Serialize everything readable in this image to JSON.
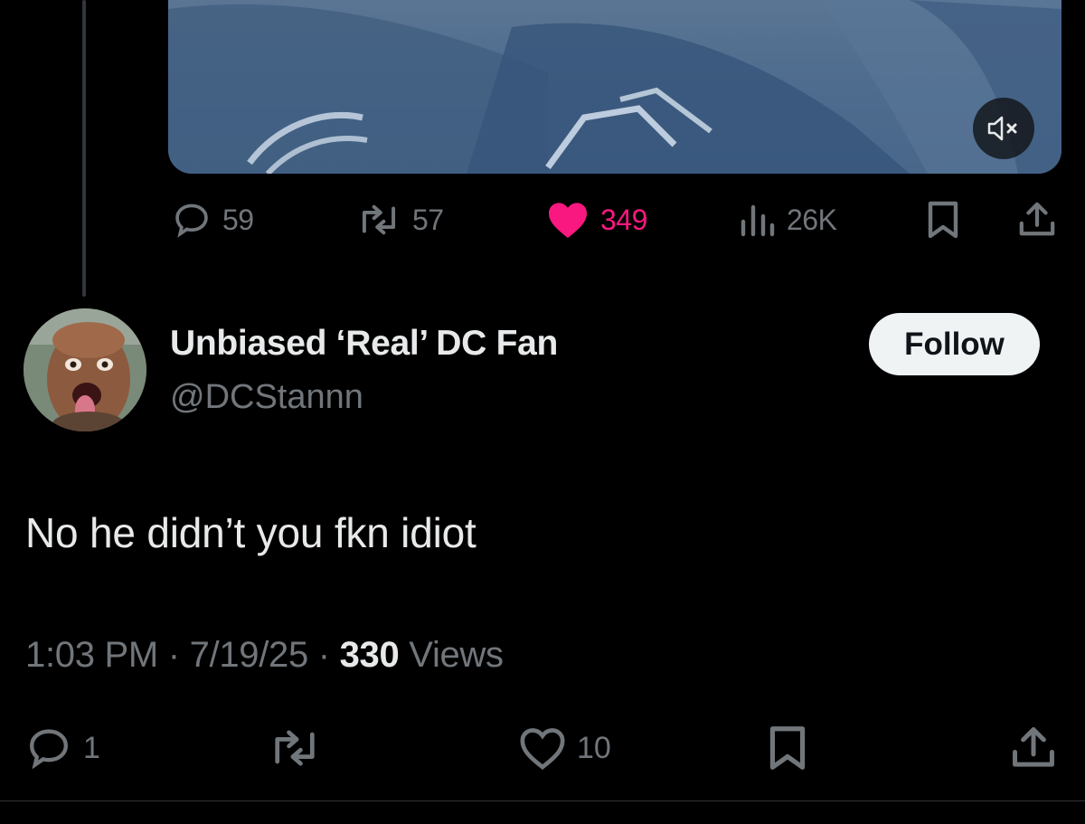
{
  "colors": {
    "background": "#000000",
    "text": "#e7e9ea",
    "muted": "#71767b",
    "like": "#f91880",
    "follow_bg": "#eff3f4"
  },
  "parent_post": {
    "media": {
      "type": "video",
      "mute_icon": "volume-muted-icon"
    },
    "actions": {
      "replies": "59",
      "reposts": "57",
      "likes": "349",
      "views": "26K"
    }
  },
  "reply": {
    "display_name": "Unbiased ‘Real’ DC Fan",
    "handle": "@DCStannn",
    "follow_label": "Follow",
    "text": "No he didn’t you fkn idiot",
    "time": "1:03 PM",
    "date": "7/19/25",
    "views_count": "330",
    "views_label": "Views",
    "separator": "·",
    "actions": {
      "replies": "1",
      "likes": "10"
    }
  }
}
